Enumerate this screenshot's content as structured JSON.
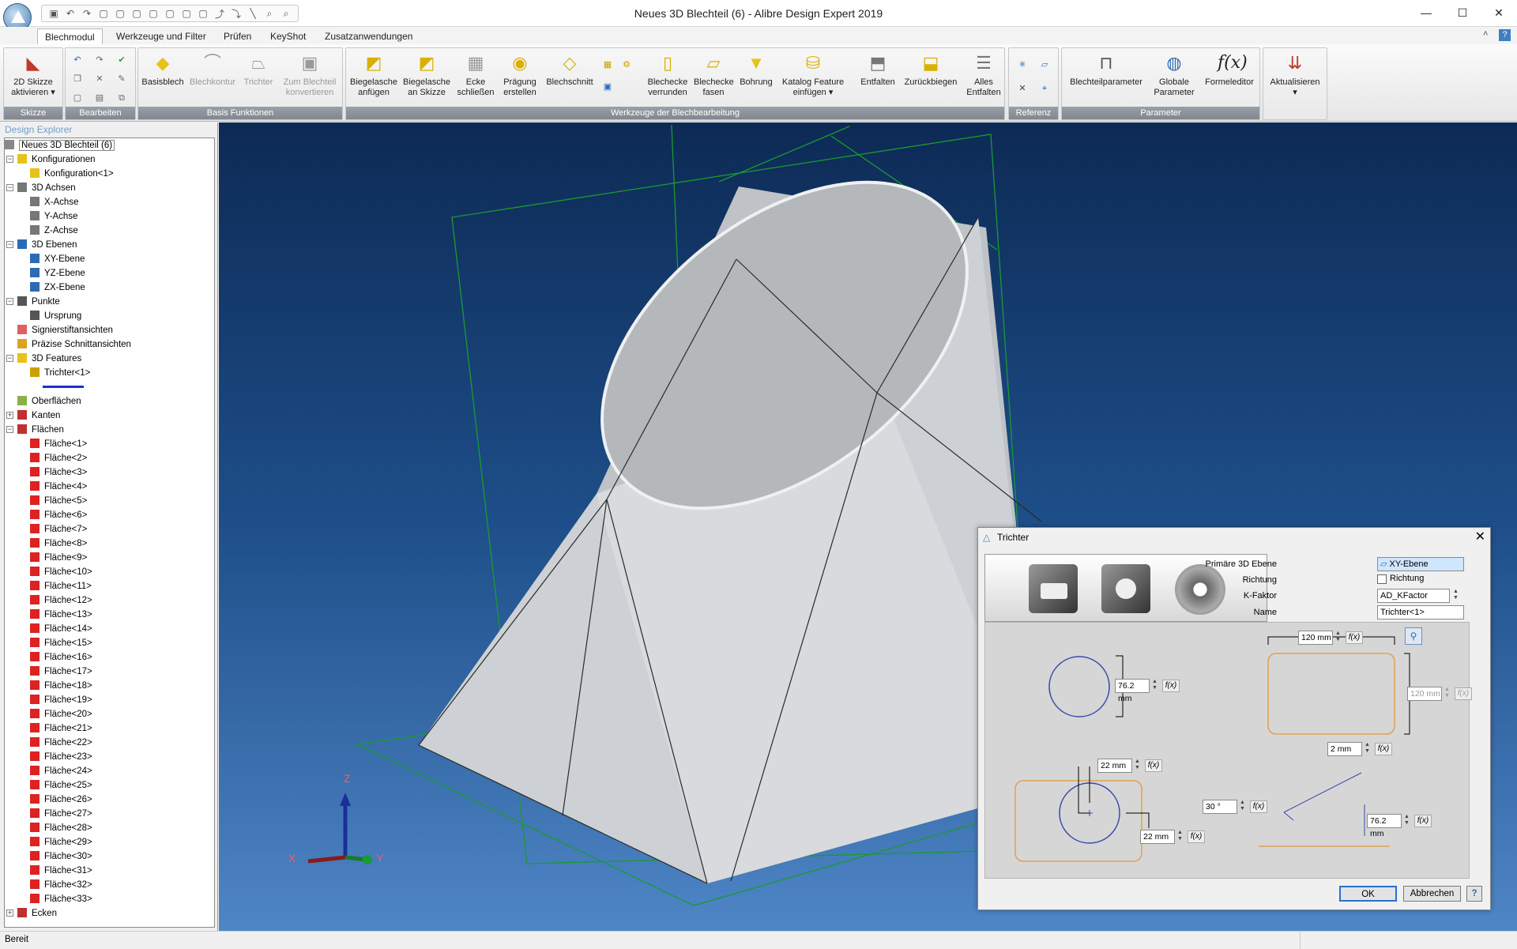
{
  "window": {
    "title": "Neues 3D Blechteil (6) - Alibre Design Expert 2019",
    "min": "—",
    "max": "☐",
    "close": "✕"
  },
  "qat": {
    "icons": [
      "save-icon",
      "undo-icon",
      "redo-icon",
      "view-icon",
      "view-icon",
      "view-icon",
      "view-icon",
      "view-icon",
      "view-icon",
      "view-icon",
      "arrow-icon",
      "arrow-icon",
      "line-icon",
      "zoom-icon",
      "zoom-icon"
    ],
    "glyphs": [
      "▣",
      "↶",
      "↷",
      "▢",
      "▢",
      "▢",
      "▢",
      "▢",
      "▢",
      "▢",
      "⤴",
      "⤵",
      "╲",
      "⌕",
      "⌕"
    ]
  },
  "tabs": [
    "Blechmodul",
    "Werkzeuge und Filter",
    "Prüfen",
    "KeyShot",
    "Zusatzanwendungen"
  ],
  "ribbon": {
    "groups": {
      "skizze": "Skizze",
      "bearbeiten": "Bearbeiten",
      "basis": "Basis Funktionen",
      "werkzeuge": "Werkzeuge der Blechbearbeitung",
      "referenz": "Referenz",
      "parameter": "Parameter"
    },
    "btn_2d": "2D Skizze\naktivieren ▾",
    "basis": [
      "Basisblech",
      "Blechkontur",
      "Trichter",
      "Zum Blechteil\nkonvertieren"
    ],
    "werkzeuge": [
      "Biegelasche\nanfügen",
      "Biegelasche\nan Skizze",
      "Ecke\nschließen",
      "Prägung\nerstellen",
      "Blechschnitt",
      "",
      "Blechecke\nverrunden",
      "Blechecke\nfasen",
      "Bohrung",
      "Katalog Feature\neinfügen ▾",
      "Entfalten",
      "Zurückbiegen",
      "Alles\nEntfalten"
    ],
    "parameter": [
      "Blechteilparameter",
      "Globale\nParameter",
      "Formeleditor"
    ],
    "aktualisieren": "Aktualisieren\n▾"
  },
  "explorer": {
    "title": "Design Explorer",
    "root": "Neues 3D Blechteil (6)",
    "nodes": [
      "Konfigurationen",
      "Konfiguration<1>",
      "3D Achsen",
      "X-Achse",
      "Y-Achse",
      "Z-Achse",
      "3D Ebenen",
      "XY-Ebene",
      "YZ-Ebene",
      "ZX-Ebene",
      "Punkte",
      "Ursprung",
      "Signierstiftansichten",
      "Präzise Schnittansichten",
      "3D Features",
      "Trichter<1>",
      "",
      "Oberflächen",
      "Kanten",
      "Flächen"
    ],
    "faces": [
      "Fläche<1>",
      "Fläche<2>",
      "Fläche<3>",
      "Fläche<4>",
      "Fläche<5>",
      "Fläche<6>",
      "Fläche<7>",
      "Fläche<8>",
      "Fläche<9>",
      "Fläche<10>",
      "Fläche<11>",
      "Fläche<12>",
      "Fläche<13>",
      "Fläche<14>",
      "Fläche<15>",
      "Fläche<16>",
      "Fläche<17>",
      "Fläche<18>",
      "Fläche<19>",
      "Fläche<20>",
      "Fläche<21>",
      "Fläche<22>",
      "Fläche<23>",
      "Fläche<24>",
      "Fläche<25>",
      "Fläche<26>",
      "Fläche<27>",
      "Fläche<28>",
      "Fläche<29>",
      "Fläche<30>",
      "Fläche<31>",
      "Fläche<32>",
      "Fläche<33>"
    ],
    "last": "Ecken"
  },
  "axes": {
    "x": "X",
    "y": "Y",
    "z": "Z"
  },
  "dialog": {
    "title": "Trichter",
    "primary_label": "Primäre 3D Ebene",
    "primary_value": "XY-Ebene",
    "richtung_label": "Richtung",
    "richtung_check": "Richtung",
    "kfaktor_label": "K-Faktor",
    "kfaktor_value": "AD_KFactor",
    "name_label": "Name",
    "name_value": "Trichter<1>",
    "w_top": "120 mm",
    "h_right": "120 mm",
    "radius": "2 mm",
    "diam_circle": "76.2 mm",
    "off_a": "22 mm",
    "off_b": "22 mm",
    "angle": "30 °",
    "height": "76.2 mm",
    "fx": "f(x)",
    "ok": "OK",
    "cancel": "Abbrechen",
    "help": "?"
  },
  "status": "Bereit"
}
